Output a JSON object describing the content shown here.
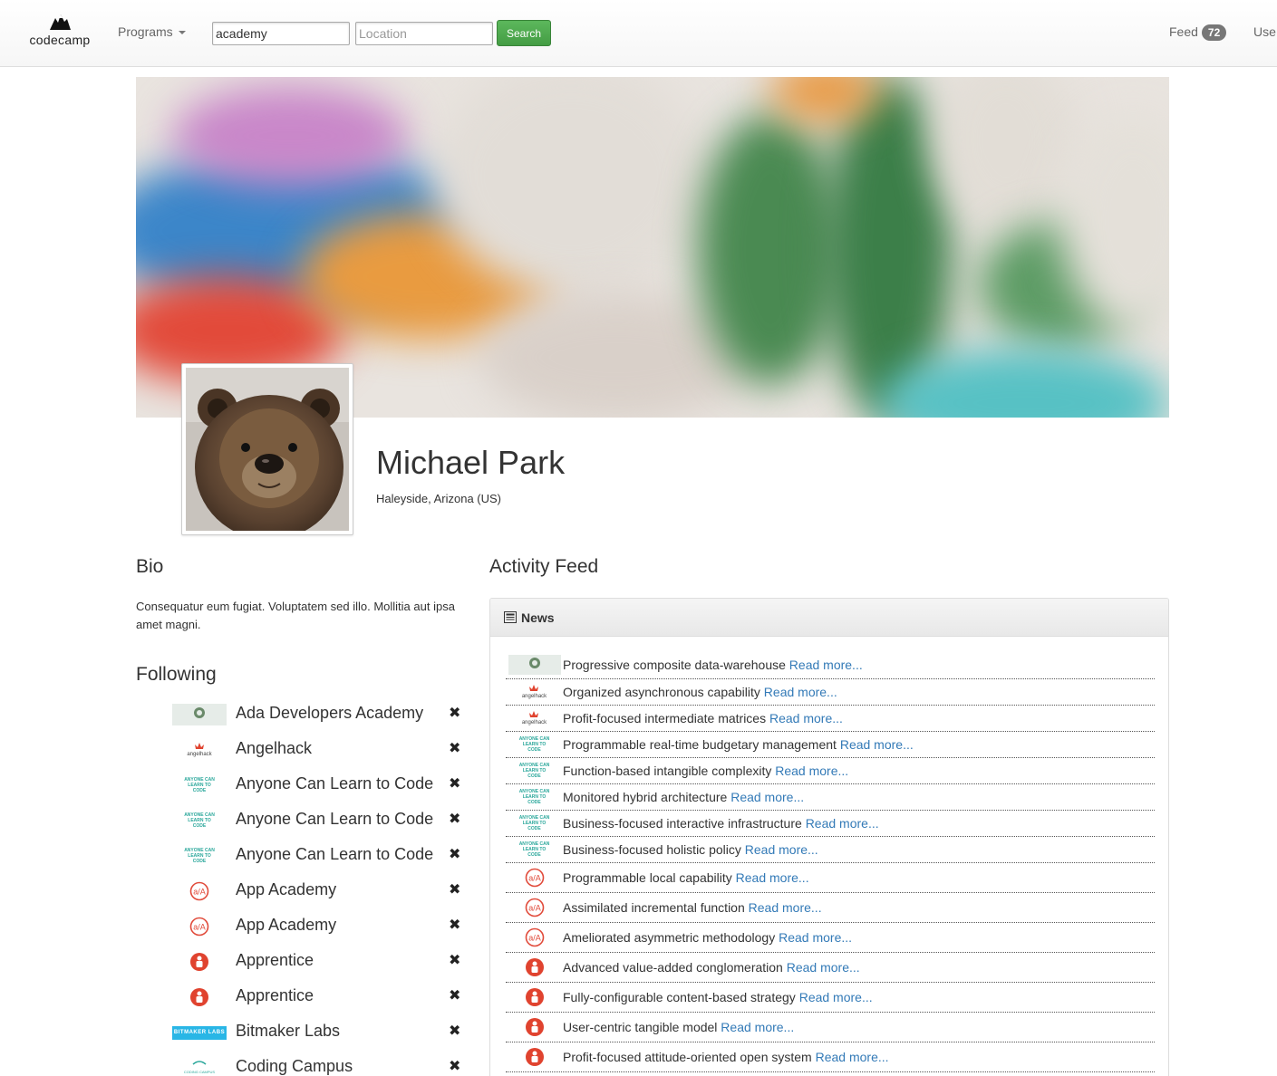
{
  "nav": {
    "brand": "codecamp",
    "programs_label": "Programs",
    "search_value": "academy",
    "location_placeholder": "Location",
    "search_button": "Search",
    "feed_label": "Feed",
    "feed_count": "72",
    "users_label": "Use"
  },
  "profile": {
    "name": "Michael Park",
    "location": "Haleyside, Arizona (US)"
  },
  "bio": {
    "heading": "Bio",
    "text": "Consequatur eum fugiat. Voluptatem sed illo. Mollitia aut ipsa amet magni."
  },
  "following": {
    "heading": "Following",
    "items": [
      {
        "name": "Ada Developers Academy",
        "logo": "ada-logo"
      },
      {
        "name": "Angelhack",
        "logo": "angelhack-logo"
      },
      {
        "name": "Anyone Can Learn to Code",
        "logo": "aclc-logo"
      },
      {
        "name": "Anyone Can Learn to Code",
        "logo": "aclc-logo"
      },
      {
        "name": "Anyone Can Learn to Code",
        "logo": "aclc-logo"
      },
      {
        "name": "App Academy",
        "logo": "app-academy-logo"
      },
      {
        "name": "App Academy",
        "logo": "app-academy-logo"
      },
      {
        "name": "Apprentice",
        "logo": "apprentice-logo"
      },
      {
        "name": "Apprentice",
        "logo": "apprentice-logo"
      },
      {
        "name": "Bitmaker Labs",
        "logo": "bitmaker-logo"
      },
      {
        "name": "Coding Campus",
        "logo": "coding-campus-logo"
      }
    ],
    "remove_glyph": "✖"
  },
  "activity": {
    "heading": "Activity Feed",
    "panel_title": "News",
    "read_more": "Read more...",
    "items": [
      {
        "text": "Progressive composite data-warehouse",
        "logo": "ada-logo"
      },
      {
        "text": "Organized asynchronous capability",
        "logo": "angelhack-logo"
      },
      {
        "text": "Profit-focused intermediate matrices",
        "logo": "angelhack-logo"
      },
      {
        "text": "Programmable real-time budgetary management",
        "logo": "aclc-logo"
      },
      {
        "text": "Function-based intangible complexity",
        "logo": "aclc-logo"
      },
      {
        "text": "Monitored hybrid architecture",
        "logo": "aclc-logo"
      },
      {
        "text": "Business-focused interactive infrastructure",
        "logo": "aclc-logo"
      },
      {
        "text": "Business-focused holistic policy",
        "logo": "aclc-logo"
      },
      {
        "text": "Programmable local capability",
        "logo": "app-academy-logo"
      },
      {
        "text": "Assimilated incremental function",
        "logo": "app-academy-logo"
      },
      {
        "text": "Ameliorated asymmetric methodology",
        "logo": "app-academy-logo"
      },
      {
        "text": "Advanced value-added conglomeration",
        "logo": "apprentice-logo"
      },
      {
        "text": "Fully-configurable content-based strategy",
        "logo": "apprentice-logo"
      },
      {
        "text": "User-centric tangible model",
        "logo": "apprentice-logo"
      },
      {
        "text": "Profit-focused attitude-oriented open system",
        "logo": "apprentice-logo"
      }
    ]
  },
  "logo_text": {
    "ada": "ADA",
    "angelhack": "angelhack",
    "aclc": "ANYONE CAN LEARN TO CODE",
    "app_academy": "a/A",
    "bitmaker": "BITMAKER LABS",
    "coding_campus": "CODING CAMPUS"
  },
  "colors": {
    "link": "#337ab7",
    "search_button": "#5cb85c",
    "app_academy_red": "#e14b3b",
    "apprentice_red": "#e0432f",
    "bitmaker_blue": "#29b6e6",
    "aclc_teal": "#2aa79b"
  }
}
